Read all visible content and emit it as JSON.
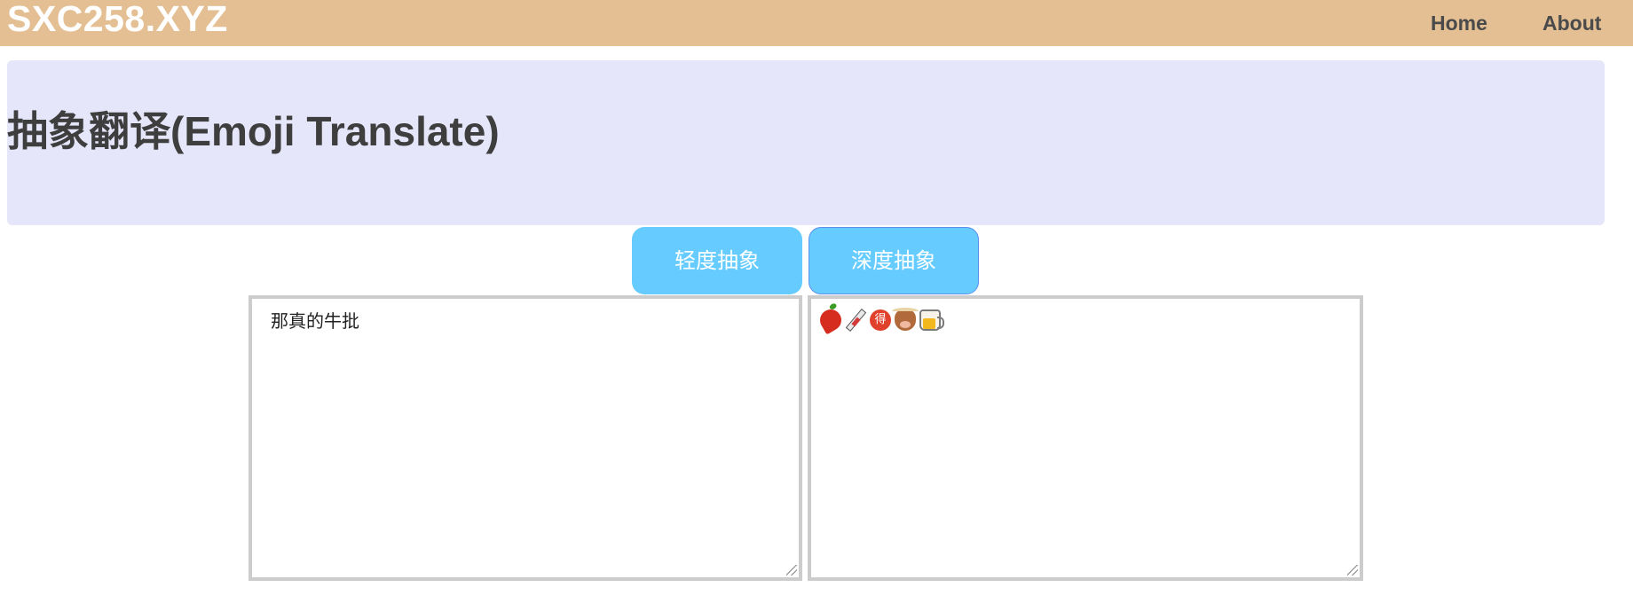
{
  "header": {
    "brand": "SXC258.XYZ",
    "nav": [
      {
        "label": "Home"
      },
      {
        "label": "About"
      }
    ],
    "background_color": "#e3bf93"
  },
  "hero": {
    "title": "抽象翻译(Emoji Translate)",
    "background_color": "#e6e6fa"
  },
  "controls": {
    "light_mode_label": "轻度抽象",
    "deep_mode_label": "深度抽象",
    "button_color": "#66ccff"
  },
  "input": {
    "value": "那真的牛批"
  },
  "output": {
    "emojis": [
      "chili-pepper-icon",
      "syringe-icon",
      "de-character-icon",
      "ox-face-icon",
      "beer-mug-icon"
    ]
  }
}
